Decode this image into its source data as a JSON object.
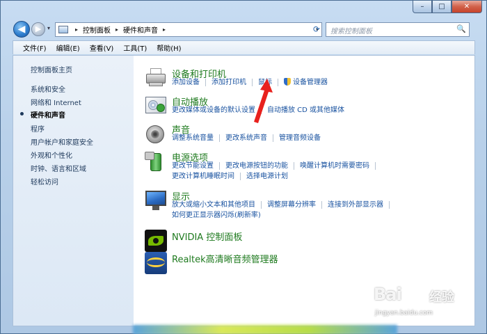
{
  "window": {
    "min_glyph": "–",
    "max_glyph": "□",
    "close_glyph": "✕"
  },
  "nav": {
    "back_glyph": "◀",
    "forward_glyph": "▶",
    "dropdown_glyph": "▾"
  },
  "address": {
    "crumbs": [
      "控制面板",
      "硬件和声音"
    ],
    "sep_glyph": "▸",
    "dropdown_glyph": "▾",
    "refresh_glyph": "⟳"
  },
  "search": {
    "placeholder": "搜索控制面板",
    "button_glyph": "🔍"
  },
  "menubar": {
    "items": [
      "文件(F)",
      "编辑(E)",
      "查看(V)",
      "工具(T)",
      "帮助(H)"
    ]
  },
  "sidebar": {
    "items": [
      {
        "label": "控制面板主页"
      },
      {
        "label": "系统和安全"
      },
      {
        "label": "网络和 Internet"
      },
      {
        "label": "硬件和声音",
        "current": true
      },
      {
        "label": "程序"
      },
      {
        "label": "用户帐户和家庭安全"
      },
      {
        "label": "外观和个性化"
      },
      {
        "label": "时钟、语言和区域"
      },
      {
        "label": "轻松访问"
      }
    ]
  },
  "categories": {
    "devices": {
      "title": "设备和打印机",
      "links": [
        "添加设备",
        "添加打印机",
        "鼠标",
        "设备管理器"
      ],
      "icon": "printer-icon"
    },
    "autoplay": {
      "title": "自动播放",
      "links": [
        "更改媒体或设备的默认设置",
        "自动播放 CD 或其他媒体"
      ],
      "icon": "autoplay-icon"
    },
    "sound": {
      "title": "声音",
      "links": [
        "调整系统音量",
        "更改系统声音",
        "管理音频设备"
      ],
      "icon": "speaker-icon"
    },
    "power": {
      "title": "电源选项",
      "links": [
        "更改节能设置",
        "更改电源按钮的功能",
        "唤醒计算机时需要密码",
        "更改计算机睡眠时间",
        "选择电源计划"
      ],
      "icon": "battery-icon"
    },
    "display": {
      "title": "显示",
      "links": [
        "放大或缩小文本和其他项目",
        "调整屏幕分辨率",
        "连接到外部显示器",
        "如何更正显示器闪烁(刷新率)"
      ],
      "icon": "monitor-icon"
    },
    "nvidia": {
      "title": "NVIDIA 控制面板",
      "icon": "nvidia-icon"
    },
    "realtek": {
      "title": "Realtek高清晰音频管理器",
      "icon": "realtek-audio-icon"
    }
  },
  "annotation": {
    "color": "#e8211d",
    "points_to": "鼠标"
  },
  "watermark": {
    "logo": "Bai",
    "cn": "经验",
    "url": "jingyan.baidu.com"
  },
  "colors": {
    "title_green": "#1e7a1e",
    "link_blue": "#1a53a0",
    "nav_text": "#1e395b"
  }
}
